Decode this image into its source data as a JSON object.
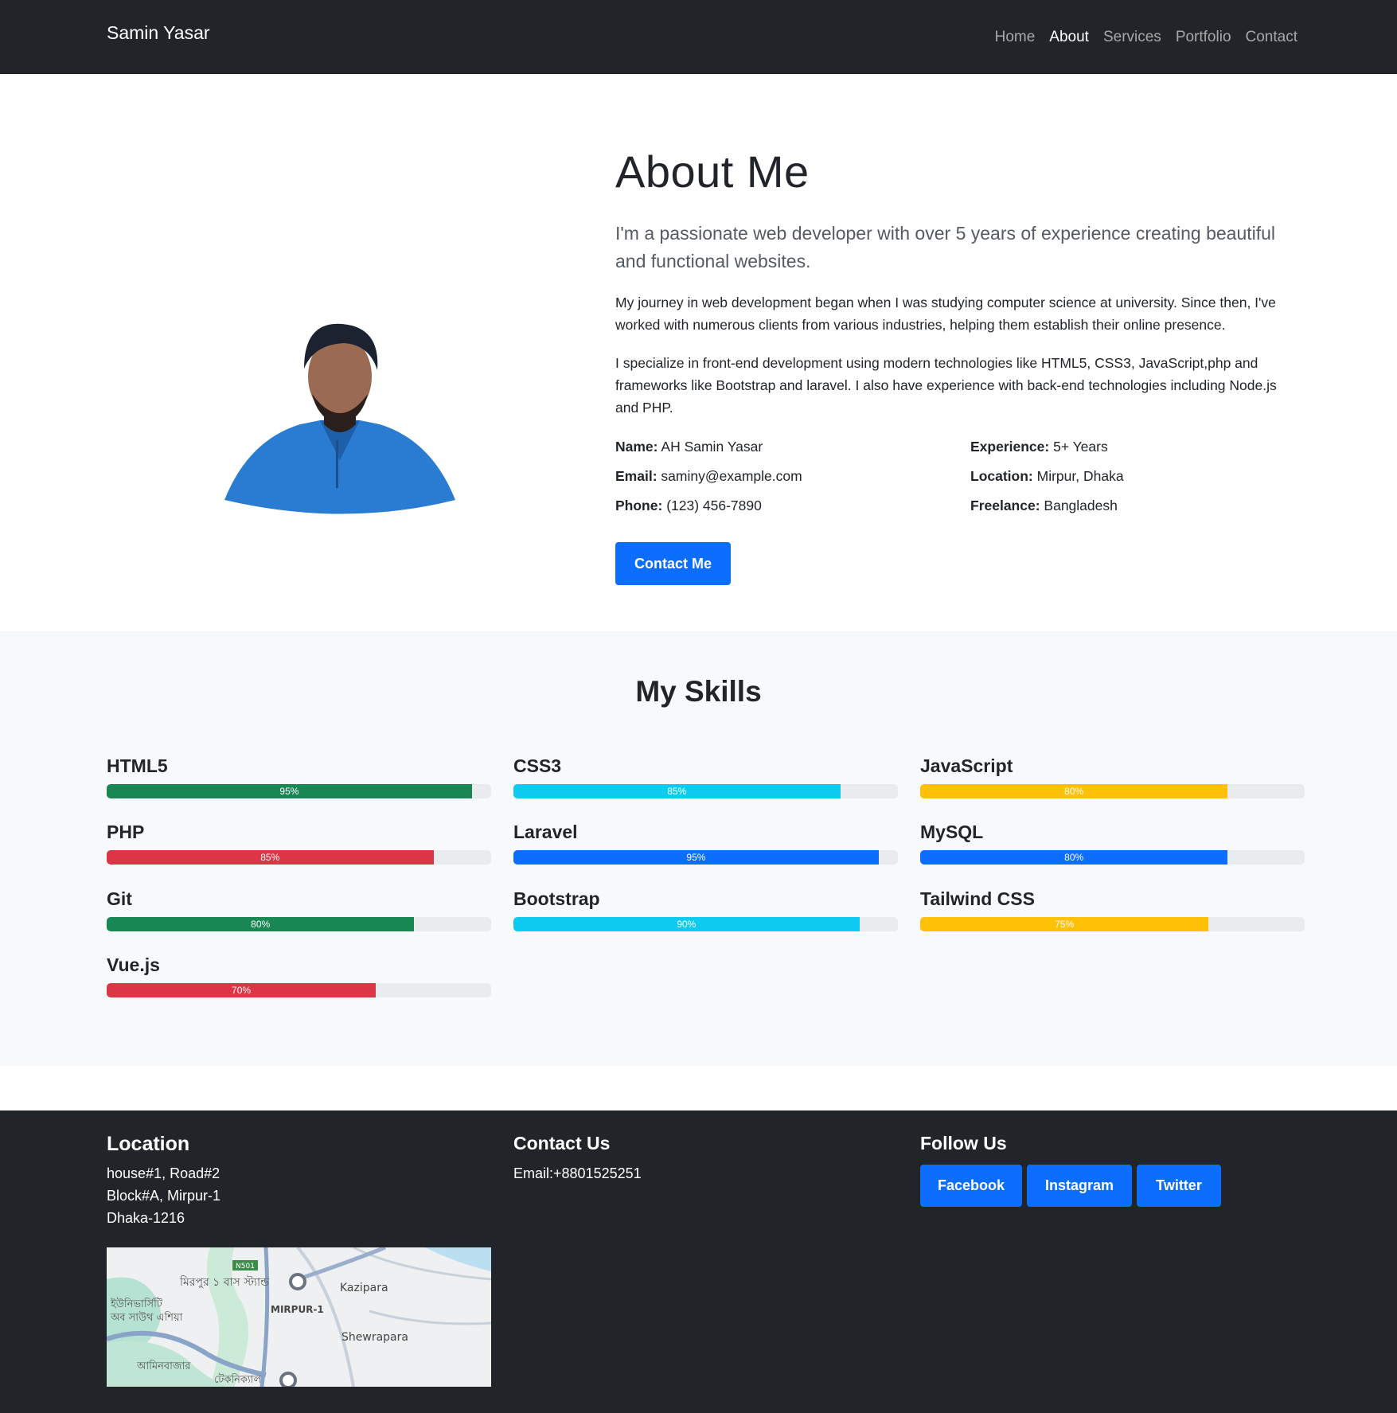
{
  "brand": "Samin Yasar",
  "nav": [
    "Home",
    "About",
    "Services",
    "Portfolio",
    "Contact"
  ],
  "about": {
    "title": "About Me",
    "lead": "I'm a passionate web developer with over 5 years of experience creating beautiful and functional websites.",
    "p1": "My journey in web development began when I was studying computer science at university. Since then, I've worked with numerous clients from various industries, helping them establish their online presence.",
    "p2": "I specialize in front-end development using modern technologies like HTML5, CSS3, JavaScript,php and frameworks like Bootstrap and laravel. I also have experience with back-end technologies including Node.js and PHP.",
    "info": [
      {
        "label": "Name:",
        "value": "AH Samin Yasar"
      },
      {
        "label": "Experience:",
        "value": "5+ Years"
      },
      {
        "label": "Email:",
        "value": "saminy@example.com"
      },
      {
        "label": "Location:",
        "value": "Mirpur, Dhaka"
      },
      {
        "label": "Phone:",
        "value": "(123) 456-7890"
      },
      {
        "label": "Freelance:",
        "value": "Bangladesh"
      }
    ],
    "button": "Contact Me"
  },
  "skills": {
    "title": "My Skills",
    "items": [
      {
        "name": "HTML5",
        "percent": 95,
        "label": "95%",
        "color": "#198754"
      },
      {
        "name": "CSS3",
        "percent": 85,
        "label": "85%",
        "color": "#0dcaf0"
      },
      {
        "name": "JavaScript",
        "percent": 80,
        "label": "80%",
        "color": "#ffc107"
      },
      {
        "name": "PHP",
        "percent": 85,
        "label": "85%",
        "color": "#dc3545"
      },
      {
        "name": "Laravel",
        "percent": 95,
        "label": "95%",
        "color": "#0d6efd"
      },
      {
        "name": "MySQL",
        "percent": 80,
        "label": "80%",
        "color": "#0d6efd"
      },
      {
        "name": "Git",
        "percent": 80,
        "label": "80%",
        "color": "#198754"
      },
      {
        "name": "Bootstrap",
        "percent": 90,
        "label": "90%",
        "color": "#0dcaf0"
      },
      {
        "name": "Tailwind CSS",
        "percent": 75,
        "label": "75%",
        "color": "#ffc107"
      },
      {
        "name": "Vue.js",
        "percent": 70,
        "label": "70%",
        "color": "#dc3545"
      }
    ]
  },
  "footer": {
    "location_title": "Location",
    "address": [
      "house#1, Road#2",
      "Block#A, Mirpur-1",
      "Dhaka-1216"
    ],
    "map_labels": [
      "N501",
      "মিরপুর ১ বাস স্ট্যান্ড",
      "Kazipara",
      "ইউনিভার্সিটি",
      "অব সাউথ এশিয়া",
      "MIRPUR-1",
      "Shewrapara",
      "আমিনবাজার",
      "টেকনিক্যাল"
    ],
    "contact_title": "Contact Us",
    "contact_email": "Email:+8801525251",
    "follow_title": "Follow Us",
    "social": [
      "Facebook",
      "Instagram",
      "Twitter"
    ]
  }
}
